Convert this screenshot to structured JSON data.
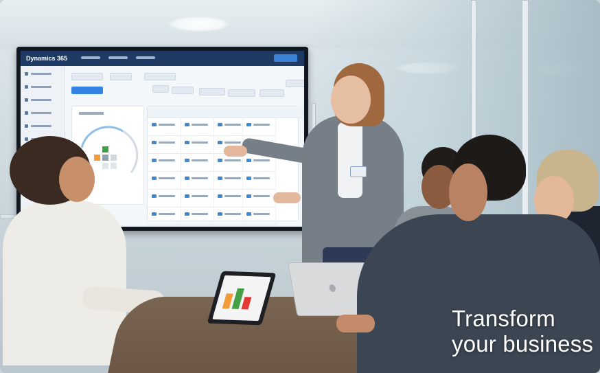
{
  "screen_app": {
    "title": "Dynamics 365"
  },
  "overlay": {
    "line1": "Transform",
    "line2": "your business"
  },
  "colors": {
    "screen_header": "#1f3b63",
    "accent_blue": "#3584e4",
    "tagline_text": "#ffffff",
    "table_wood": "#6b5646",
    "presenter_blazer": "#767f88",
    "right_person_suit": "#3c4652"
  },
  "icons": [
    "ceiling-light-icon",
    "apple-logo-icon"
  ]
}
